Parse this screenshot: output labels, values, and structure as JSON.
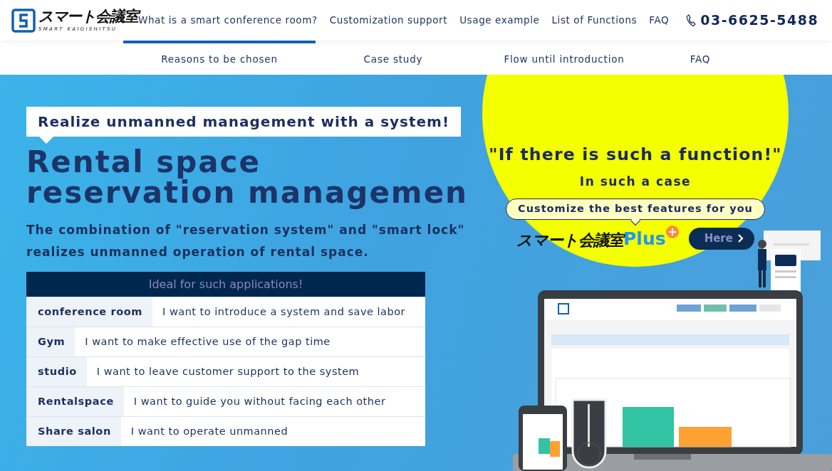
{
  "logo": {
    "text": "スマート会議室",
    "subtitle": "SMART KAIGISHITSU"
  },
  "nav": [
    "What is a smart conference room?",
    "Customization support",
    "Usage example",
    "List of Functions",
    "FAQ"
  ],
  "phone": "03-6625-5488",
  "subnav": [
    {
      "label": "Reasons to be chosen",
      "selected": true
    },
    {
      "label": "Case study",
      "selected": false
    },
    {
      "label": "Flow until introduction",
      "selected": false
    },
    {
      "label": "FAQ",
      "selected": false
    }
  ],
  "hero": {
    "tag": "Realize unmanned management with a system!",
    "title_lines": [
      "Rental space",
      "reservation managemen"
    ],
    "lead": "The combination of \"reservation system\" and \"smart lock\" realizes unmanned operation of rental space.",
    "table": {
      "heading": "Ideal for such applications!",
      "rows": [
        {
          "use": "conference room",
          "need": "I want to introduce a system and save labor"
        },
        {
          "use": "Gym",
          "need": "I want to make effective use of the gap time"
        },
        {
          "use": "studio",
          "need": "I want to leave customer support to the system"
        },
        {
          "use": "Rentalspace",
          "need": "I want to guide you without facing each other"
        },
        {
          "use": "Share salon",
          "need": "I want to operate unmanned"
        }
      ]
    }
  },
  "promo": {
    "headline": "\"If there is such a function!\"",
    "subhead": "In such a case",
    "bubble": "Customize the best features for you",
    "brand": "スマート会議室",
    "brand_suffix": "Plus",
    "button": "Here"
  }
}
